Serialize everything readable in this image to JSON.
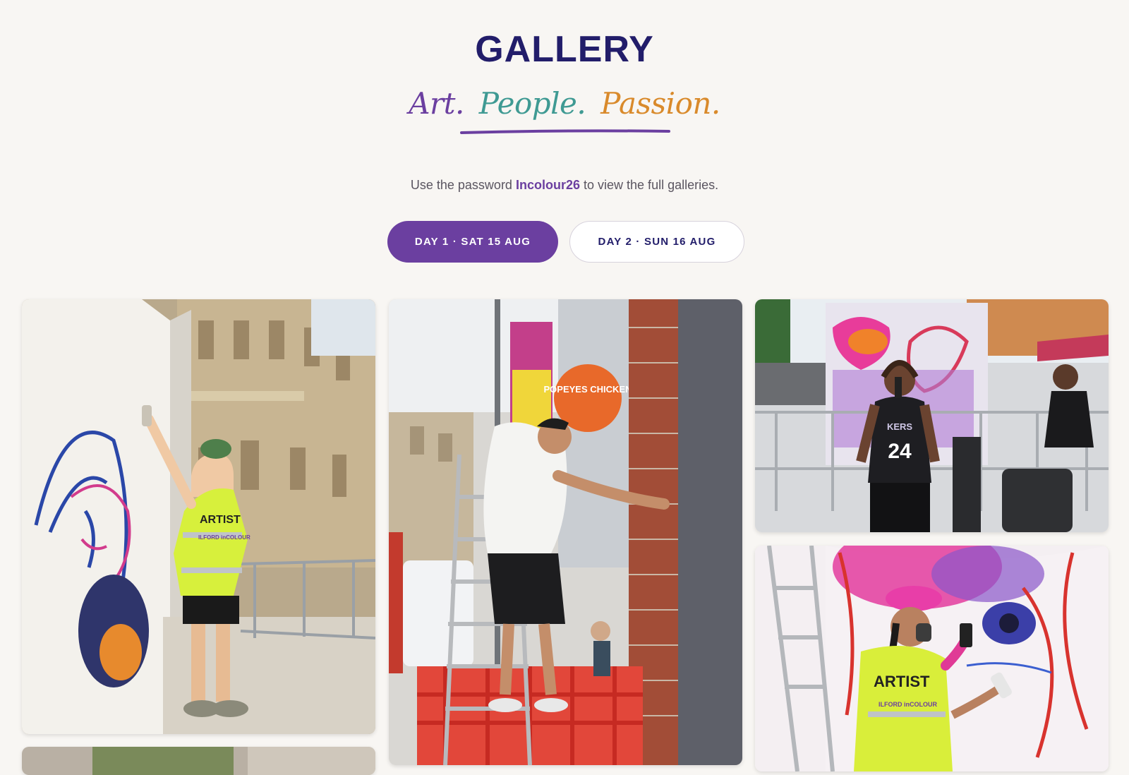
{
  "header": {
    "title": "GALLERY",
    "tagline": [
      {
        "text": "Art.",
        "color": "#6b3fa0"
      },
      {
        "text": "People.",
        "color": "#3f9a93"
      },
      {
        "text": "Passion.",
        "color": "#d98a2b"
      }
    ]
  },
  "notice": {
    "prefix": "Use the password",
    "password": "Incolour26",
    "suffix": "to view the full galleries."
  },
  "tabs": [
    {
      "label": "DAY 1 · SAT 15 AUG",
      "active": true
    },
    {
      "label": "DAY 2 · SUN 16 AUG",
      "active": false
    }
  ],
  "colors": {
    "accent": "#6b3fa0",
    "navy": "#221d6a",
    "background": "#f8f6f3"
  },
  "photos": {
    "p1": {
      "vest_text": "ARTIST",
      "vest_brand": "ILFORD inCOLOUR"
    },
    "p2": {
      "sign_text": "POPEYES CHICKEN"
    },
    "p3": {
      "jersey_text": "KERS",
      "jersey_number": "24"
    },
    "p4": {
      "vest_text": "ARTIST",
      "vest_brand": "ILFORD inCOLOUR"
    }
  }
}
